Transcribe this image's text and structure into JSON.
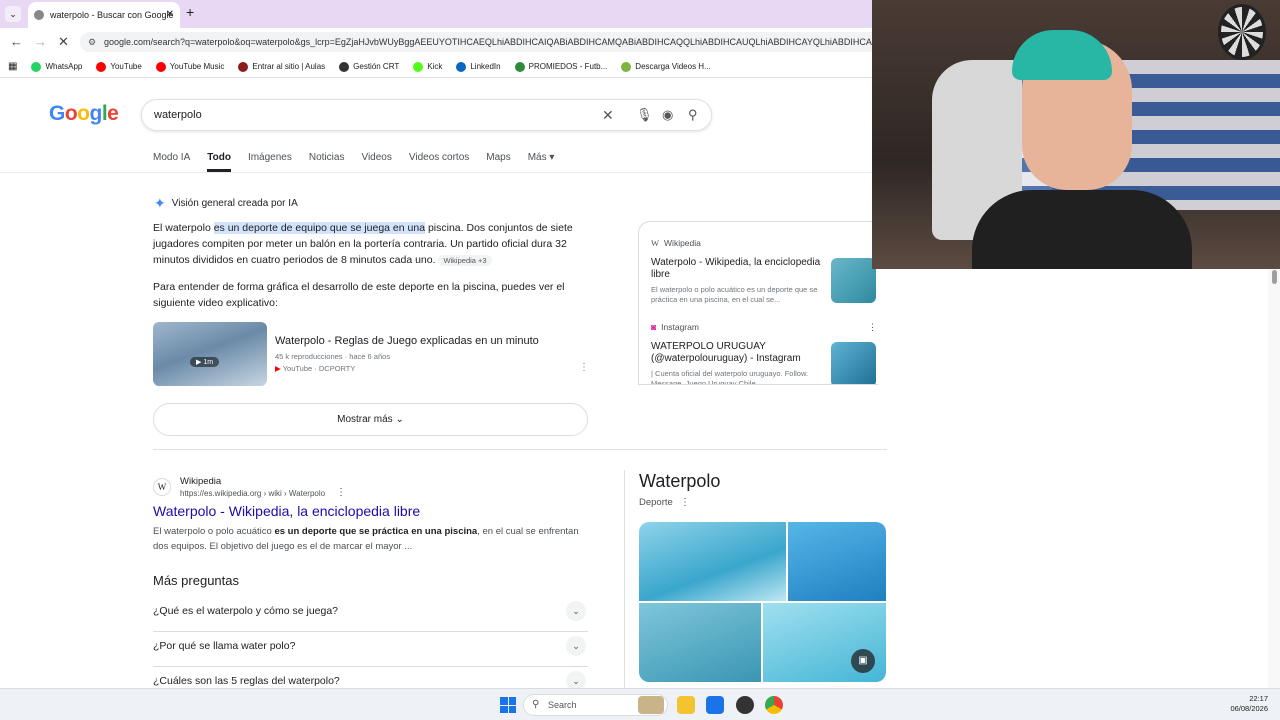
{
  "browser": {
    "tab_title": "waterpolo - Buscar con Google",
    "tab_close": "✕",
    "new_tab": "+",
    "tablist": "⌄",
    "url": "google.com/search?q=waterpolo&oq=waterpolo&gs_lcrp=EgZjaHJvbWUyBggAEEUYOTIHCAEQLhiABDIHCAIQABiABDIHCAMQABiABDIHCAQQLhiABDIHCAUQLhiABDIHCAYQLhiABDIHCA",
    "bookmarks": [
      {
        "label": "WhatsApp",
        "color": "#25d366"
      },
      {
        "label": "YouTube",
        "color": "#ff0000"
      },
      {
        "label": "YouTube Music",
        "color": "#ff0000"
      },
      {
        "label": "Entrar al sitio | Aulas",
        "color": "#8b1c1c"
      },
      {
        "label": "Gestión CRT",
        "color": "#333333"
      },
      {
        "label": "Kick",
        "color": "#53fc18"
      },
      {
        "label": "LinkedIn",
        "color": "#0a66c2"
      },
      {
        "label": "PROMIEDOS - Futb...",
        "color": "#2e8b3a"
      },
      {
        "label": "Descarga Videos H...",
        "color": "#7cb342"
      }
    ]
  },
  "google": {
    "logo_letters": [
      {
        "ch": "G",
        "color": "#4285f4"
      },
      {
        "ch": "o",
        "color": "#ea4335"
      },
      {
        "ch": "o",
        "color": "#fbbc05"
      },
      {
        "ch": "g",
        "color": "#4285f4"
      },
      {
        "ch": "l",
        "color": "#34a853"
      },
      {
        "ch": "e",
        "color": "#ea4335"
      }
    ],
    "query": "waterpolo",
    "tabs": [
      "Modo IA",
      "Todo",
      "Imágenes",
      "Noticias",
      "Videos",
      "Videos cortos",
      "Maps",
      "Más"
    ],
    "active_tab": "Todo"
  },
  "ai_overview": {
    "heading": "Visión general creada por IA",
    "p1_pre": "El waterpolo ",
    "p1_hl": "es un deporte de equipo que se juega en una",
    "p1_post": " piscina. Dos conjuntos de siete jugadores compiten por meter un balón en la portería contraria. Un partido oficial dura 32 minutos divididos en cuatro periodos de 8 minutos cada uno.",
    "p1_chip": "Wikipedia +3",
    "p2": "Para entender de forma gráfica el desarrollo de este deporte en la piscina, puedes ver el siguiente video explicativo:",
    "video": {
      "title": "Waterpolo - Reglas de Juego explicadas en un minuto",
      "meta": "45 k reproducciones · hace 6 años",
      "source": "YouTube · DCPORTY",
      "duration": "▶ 1m"
    },
    "show_more": "Mostrar más"
  },
  "sources": [
    {
      "site": "Wikipedia",
      "title": "Waterpolo - Wikipedia, la enciclopedia libre",
      "desc": "El waterpolo o polo acuático es un deporte que se práctica en una piscina, en el cual se..."
    },
    {
      "site": "Instagram",
      "title": "WATERPOLO URUGUAY (@waterpolouruguay) - Instagram",
      "desc": "| Cuenta oficial del waterpolo uruguayo. Follow. Message. Juego Uruguay Chile..."
    }
  ],
  "result": {
    "site": "Wikipedia",
    "url": "https://es.wikipedia.org › wiki › Waterpolo",
    "title": "Waterpolo - Wikipedia, la enciclopedia libre",
    "snippet_pre": "El waterpolo o polo acuático ",
    "snippet_bold": "es un deporte que se práctica en una piscina",
    "snippet_post": ", en el cual se enfrentan dos equipos. El objetivo del juego es el de marcar el mayor ..."
  },
  "paa": {
    "title": "Más preguntas",
    "questions": [
      "¿Qué es el waterpolo y cómo se juega?",
      "¿Por qué se llama water polo?",
      "¿Cuáles son las 5 reglas del waterpolo?"
    ]
  },
  "knowledge_panel": {
    "title": "Waterpolo",
    "subtitle": "Deporte"
  },
  "taskbar": {
    "search_placeholder": "Search",
    "time": "22:17",
    "date": "06/08/2026"
  }
}
